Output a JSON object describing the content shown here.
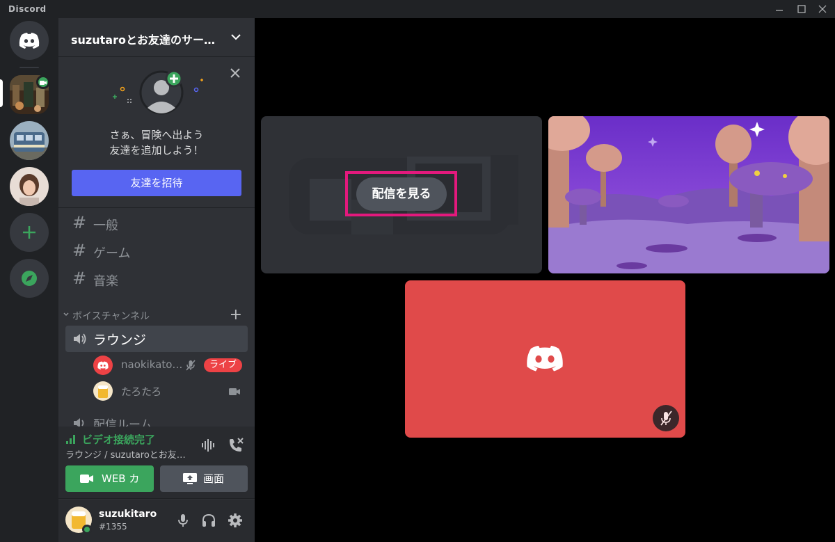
{
  "window": {
    "title": "Discord"
  },
  "colors": {
    "rail_bg": "#202225",
    "sidebar_bg": "#2f3136",
    "blurple": "#5865f2",
    "green": "#3ba55d",
    "red": "#ed4245",
    "highlight": "#e3197d"
  },
  "rail": {
    "home_icon": "discord-logo-icon",
    "servers": [
      "server-photo-market",
      "server-photo-train",
      "server-photo-person"
    ],
    "add_icon": "plus-icon",
    "explore_icon": "compass-icon"
  },
  "server": {
    "name": "suzutaroとお友達のサー…"
  },
  "invite": {
    "line1": "さぁ、冒険へ出よう",
    "line2": "友達を追加しよう！",
    "button": "友達を招待"
  },
  "text_channels": [
    {
      "name": "一般"
    },
    {
      "name": "ゲーム"
    },
    {
      "name": "音楽"
    }
  ],
  "voice": {
    "category": "ボイスチャンネル",
    "active_channel": "ラウンジ",
    "users": [
      {
        "name": "naokikato…",
        "badge": "ライブ"
      },
      {
        "name": "たろたろ"
      }
    ],
    "next_channel": "配信ルーム"
  },
  "connection": {
    "status": "ビデオ接続完了",
    "subtitle": "ラウンジ / suzutaroとお友…",
    "camera_label": "WEB カ",
    "share_label": "画面"
  },
  "user": {
    "name": "suzukitaro",
    "tag": "#1355"
  },
  "stage": {
    "watch_label": "配信を見る"
  }
}
